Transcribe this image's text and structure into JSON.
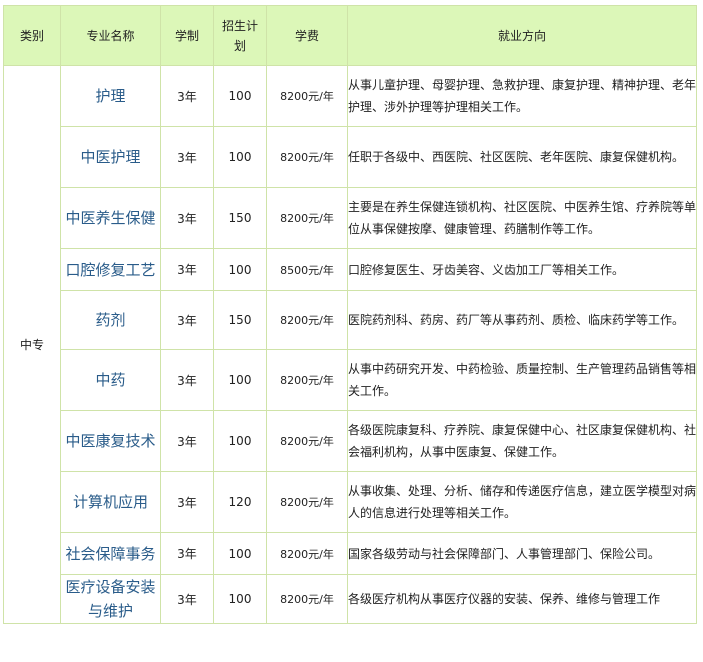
{
  "headers": {
    "category": "类别",
    "major": "专业名称",
    "duration": "学制",
    "quota": "招生计划",
    "fee": "学费",
    "career": "就业方向"
  },
  "category_value": "中专",
  "rows": [
    {
      "major": "护理",
      "duration": "3年",
      "quota": "100",
      "fee": "8200元/年",
      "career": "从事儿童护理、母婴护理、急救护理、康复护理、精神护理、老年护理、涉外护理等护理相关工作。"
    },
    {
      "major": "中医护理",
      "duration": "3年",
      "quota": "100",
      "fee": "8200元/年",
      "career": "任职于各级中、西医院、社区医院、老年医院、康复保健机构。"
    },
    {
      "major": "中医养生保健",
      "duration": "3年",
      "quota": "150",
      "fee": "8200元/年",
      "career": "主要是在养生保健连锁机构、社区医院、中医养生馆、疗养院等单位从事保健按摩、健康管理、药膳制作等工作。"
    },
    {
      "major": "口腔修复工艺",
      "duration": "3年",
      "quota": "100",
      "fee": "8500元/年",
      "career": "口腔修复医生、牙齿美容、义齿加工厂等相关工作。"
    },
    {
      "major": "药剂",
      "duration": "3年",
      "quota": "150",
      "fee": "8200元/年",
      "career": "医院药剂科、药房、药厂等从事药剂、质检、临床药学等工作。"
    },
    {
      "major": "中药",
      "duration": "3年",
      "quota": "100",
      "fee": "8200元/年",
      "career": "从事中药研究开发、中药检验、质量控制、生产管理药品销售等相关工作。"
    },
    {
      "major": "中医康复技术",
      "duration": "3年",
      "quota": "100",
      "fee": "8200元/年",
      "career": "各级医院康复科、疗养院、康复保健中心、社区康复保健机构、社会福利机构，从事中医康复、保健工作。"
    },
    {
      "major": "计算机应用",
      "duration": "3年",
      "quota": "120",
      "fee": "8200元/年",
      "career": "从事收集、处理、分析、储存和传递医疗信息，建立医学模型对病人的信息进行处理等相关工作。"
    },
    {
      "major": "社会保障事务",
      "duration": "3年",
      "quota": "100",
      "fee": "8200元/年",
      "career": "国家各级劳动与社会保障部门、人事管理部门、保险公司。"
    },
    {
      "major": "医疗设备安装与维护",
      "duration": "3年",
      "quota": "100",
      "fee": "8200元/年",
      "career": "各级医疗机构从事医疗仪器的安装、保养、维修与管理工作"
    }
  ]
}
